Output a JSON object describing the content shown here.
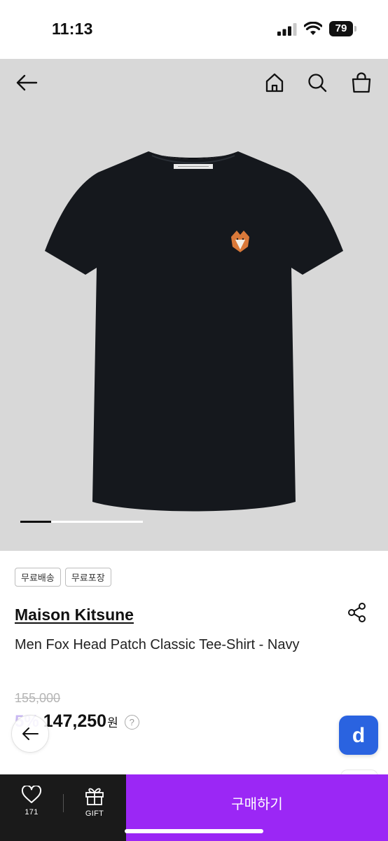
{
  "status_bar": {
    "time": "11:13",
    "battery": "79"
  },
  "product": {
    "badges": [
      "무료배송",
      "무료포장"
    ],
    "brand": "Maison Kitsune",
    "name": "Men Fox Head Patch Classic Tee-Shirt - Navy",
    "original_price": "155,000",
    "discount": "5%",
    "price": "147,250",
    "currency": "원",
    "help": "?",
    "image_count_progress": 0.25,
    "colors": {
      "shirt": "#15181d",
      "gallery_bg": "#d8d8d8"
    }
  },
  "floating": {
    "app_logo_letter": "d"
  },
  "bottom_bar": {
    "like_count": "171",
    "gift_label": "GIFT",
    "buy_label": "구매하기",
    "buy_color": "#9b27f5"
  },
  "icons": {
    "nav": [
      "arrow-left-icon",
      "home-icon",
      "search-icon",
      "shopping-bag-icon"
    ],
    "share": "share-icon",
    "like": "heart-icon",
    "gift": "gift-icon"
  }
}
